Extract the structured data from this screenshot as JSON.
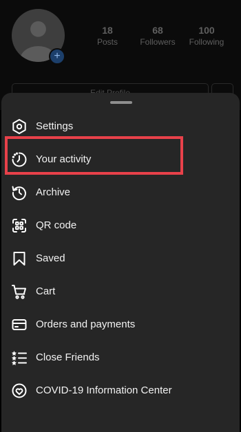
{
  "profile": {
    "stats": [
      {
        "number": "18",
        "label": "Posts"
      },
      {
        "number": "68",
        "label": "Followers"
      },
      {
        "number": "100",
        "label": "Following"
      }
    ],
    "edit_profile_label": "Edit Profile"
  },
  "menu": {
    "items": [
      {
        "label": "Settings",
        "icon": "settings-icon"
      },
      {
        "label": "Your activity",
        "icon": "activity-icon"
      },
      {
        "label": "Archive",
        "icon": "archive-icon"
      },
      {
        "label": "QR code",
        "icon": "qr-code-icon"
      },
      {
        "label": "Saved",
        "icon": "bookmark-icon"
      },
      {
        "label": "Cart",
        "icon": "cart-icon"
      },
      {
        "label": "Orders and payments",
        "icon": "card-icon"
      },
      {
        "label": "Close Friends",
        "icon": "close-friends-icon"
      },
      {
        "label": "COVID-19 Information Center",
        "icon": "covid-info-icon"
      }
    ],
    "highlighted_item": "Your activity",
    "highlight_color": "#e8414a"
  }
}
